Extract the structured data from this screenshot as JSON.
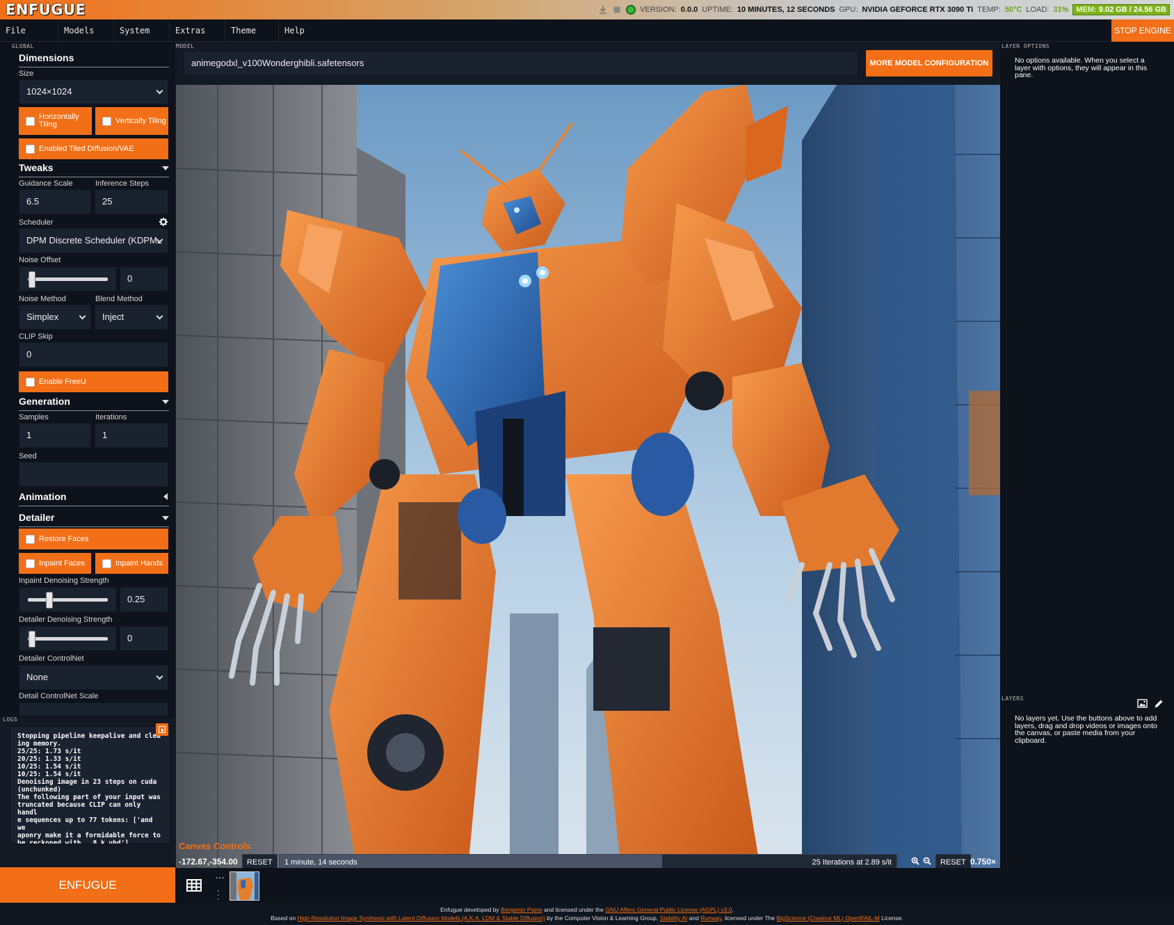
{
  "header": {
    "logo": "ENFUGUE",
    "version_label": "VERSION:",
    "version": "0.0.0",
    "uptime_label": "UPTIME:",
    "uptime": "10 MINUTES, 12 SECONDS",
    "gpu_label": "GPU:",
    "gpu": "NVIDIA GEFORCE RTX 3090 TI",
    "temp_label": "TEMP:",
    "temp": "50°C",
    "load_label": "LOAD:",
    "load": "31%",
    "mem_label": "MEM:",
    "mem": "9.02 GB / 24.56 GB"
  },
  "menu": {
    "items": [
      "File",
      "Models",
      "System",
      "Extras",
      "Theme",
      "Help"
    ],
    "stop_engine": "STOP ENGINE"
  },
  "left": {
    "global_label": "GLOBAL",
    "dimensions": {
      "title": "Dimensions",
      "size_label": "Size",
      "size_value": "1024×1024",
      "horizontally_tiling": "Horizontally Tiling",
      "vertically_tiling": "Vertically Tiling",
      "tiled_diffusion": "Enabled Tiled Diffusion/VAE"
    },
    "tweaks": {
      "title": "Tweaks",
      "guidance_scale_label": "Guidance Scale",
      "guidance_scale": "6.5",
      "inference_steps_label": "Inference Steps",
      "inference_steps": "25",
      "scheduler_label": "Scheduler",
      "scheduler": "DPM Discrete Scheduler (KDPM2",
      "noise_offset_label": "Noise Offset",
      "noise_offset": "0",
      "noise_method_label": "Noise Method",
      "noise_method": "Simplex",
      "blend_method_label": "Blend Method",
      "blend_method": "Inject",
      "clip_skip_label": "CLIP Skip",
      "clip_skip": "0",
      "enable_freeu": "Enable FreeU"
    },
    "generation": {
      "title": "Generation",
      "samples_label": "Samples",
      "samples": "1",
      "iterations_label": "Iterations",
      "iterations": "1",
      "seed_label": "Seed",
      "seed": ""
    },
    "animation": {
      "title": "Animation"
    },
    "detailer": {
      "title": "Detailer",
      "restore_faces": "Restore Faces",
      "inpaint_faces": "Inpaint Faces",
      "inpaint_hands": "Inpaint Hands",
      "inpaint_denoising_label": "Inpaint Denoising Strength",
      "inpaint_denoising": "0.25",
      "detailer_denoising_label": "Detailer Denoising Strength",
      "detailer_denoising": "0",
      "detailer_controlnet_label": "Detailer ControlNet",
      "detailer_controlnet": "None",
      "detail_controlnet_scale_label": "Detail ControlNet Scale"
    },
    "logs_label": "LOGS",
    "logs": "Stopping pipeline keepalive and clea\ning memory.\n25/25: 1.73 s/it\n20/25: 1.33 s/it\n10/25: 1.54 s/it\n10/25: 1.54 s/it\nDenoising image in 23 steps on cuda\n(unchunked)\nThe following part of your input was\ntruncated because CLIP can only handl\ne sequences up to 77 tokens: ['and we\naponry make it a formidable force to\nbe reckoned with., 8 k uhd']",
    "enfugue_button": "ENFUGUE"
  },
  "model": {
    "label": "MODEL",
    "value": "animegodxl_v100Wonderghibli.safetensors",
    "more_button": "MORE MODEL CONFIGURATION"
  },
  "canvas": {
    "controls_title": "Canvas Controls",
    "coords": "-172.67,-354.00",
    "reset": "RESET",
    "elapsed": "1 minute, 14 seconds",
    "rate": "25 Iterations at 2.89 s/it",
    "progress": 0.62,
    "zoom_reset": "RESET",
    "zoom": "0.750×"
  },
  "right": {
    "layer_options_label": "LAYER OPTIONS",
    "layer_options_text": "No options available. When you select a layer with options, they will appear in this pane.",
    "layers_label": "LAYERS",
    "layers_text": "No layers yet. Use the buttons above to add layers, drag and drop videos or images onto the canvas, or paste media from your clipboard."
  },
  "footer": {
    "line1_a": "Enfugue developed by ",
    "author": "Benjamin Paine",
    "line1_b": " and licensed under the ",
    "license": "GNU Affero General Public License (AGPL) v3.0",
    "line1_c": ".",
    "line2_a": "Based on ",
    "paper": "High-Resolution Image Synthesis with Latent Diffusion Models (A.K.A. LDM & Stable Diffusion)",
    "line2_b": " by the Computer Vision & Learning Group, ",
    "stability": "Stability AI",
    "line2_c": " and ",
    "runway": "Runway",
    "line2_d": ", licensed under The ",
    "openrail": "BigScience (Creative ML) OpenRAIL-M",
    "line2_e": " License."
  },
  "colors": {
    "accent": "#f26f17",
    "panel": "#0d121b",
    "field": "#1a2230"
  }
}
